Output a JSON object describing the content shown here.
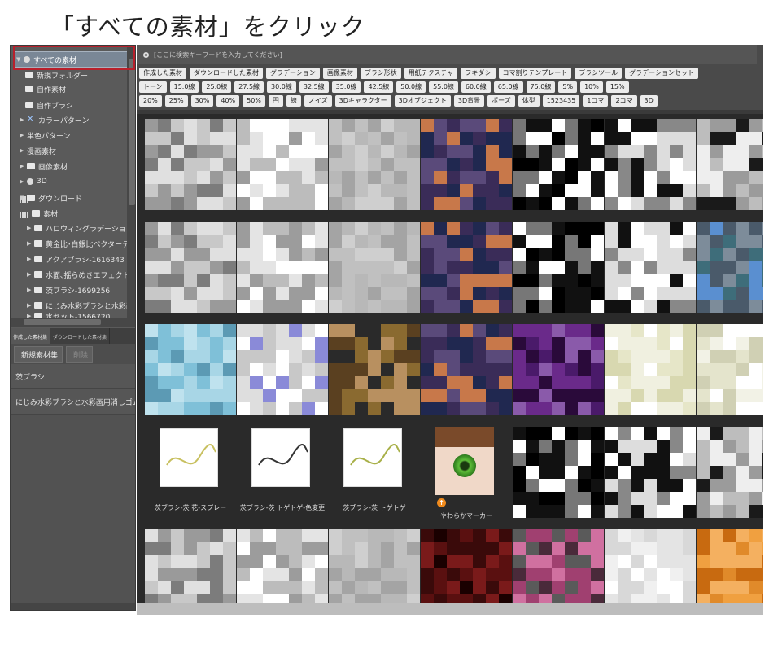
{
  "caption": "「すべての素材」をクリック",
  "tree": {
    "selected": "すべての素材",
    "items": [
      {
        "label": "新規フォルダー",
        "icon": "folder"
      },
      {
        "label": "自作素材",
        "icon": "folder"
      },
      {
        "label": "自作ブラシ",
        "icon": "folder"
      },
      {
        "label": "カラーパターン",
        "icon": "color-pattern"
      },
      {
        "label": "単色パターン",
        "icon": "mono-pattern"
      },
      {
        "label": "漫画素材",
        "icon": "manga"
      },
      {
        "label": "画像素材",
        "icon": "image"
      },
      {
        "label": "3D",
        "icon": "3d"
      },
      {
        "label": "ダウンロード",
        "icon": "folder"
      },
      {
        "label": "素材",
        "icon": "folder"
      },
      {
        "label": "ハロウィングラデーションマップ",
        "icon": "folder"
      },
      {
        "label": "黄金比･白銀比ベクターテン",
        "icon": "folder"
      },
      {
        "label": "アクアブラシ-1616343",
        "icon": "folder"
      },
      {
        "label": "水面､揺らめきエフェクト-15",
        "icon": "folder"
      },
      {
        "label": "茨ブラシ-1699256",
        "icon": "folder"
      },
      {
        "label": "にじみ水彩ブラシと水彩画用",
        "icon": "folder"
      },
      {
        "label": "水セット-1566720",
        "icon": "folder"
      }
    ]
  },
  "tabs": [
    "作成した素材集",
    "ダウンロードした素材集"
  ],
  "toolbar2": {
    "new_label": "新規素材集",
    "delete_label": "削除"
  },
  "material_sets": [
    "茨ブラシ",
    "にじみ水彩ブラシと水彩画用消しゴム"
  ],
  "search": {
    "placeholder": "[ここに検索キーワードを入力してください]"
  },
  "tag_rows": [
    [
      "作成した素材",
      "ダウンロードした素材",
      "グラデーション",
      "画像素材",
      "ブラシ形状",
      "用紙テクスチャ",
      "フキダシ",
      "コマ割りテンプレート",
      "ブラシツール",
      "グラデーションセット"
    ],
    [
      "トーン",
      "15.0線",
      "25.0線",
      "27.5線",
      "30.0線",
      "32.5線",
      "35.0線",
      "42.5線",
      "50.0線",
      "55.0線",
      "60.0線",
      "65.0線",
      "75.0線",
      "5%",
      "10%",
      "15%"
    ],
    [
      "20%",
      "25%",
      "30%",
      "40%",
      "50%",
      "円",
      "線",
      "ノイズ",
      "3Dキャラクター",
      "3Dオブジェクト",
      "3D背景",
      "ポーズ",
      "体型",
      "1523435",
      "1コマ",
      "2コマ",
      "3D"
    ]
  ],
  "items_row4": [
    {
      "label": "茨ブラシ-茨 花-スプレー"
    },
    {
      "label": "茨ブラシ-茨 トゲトゲ-色変更"
    },
    {
      "label": "茨ブラシ-茨 トゲトゲ"
    },
    {
      "label": "やわらかマーカー"
    }
  ]
}
